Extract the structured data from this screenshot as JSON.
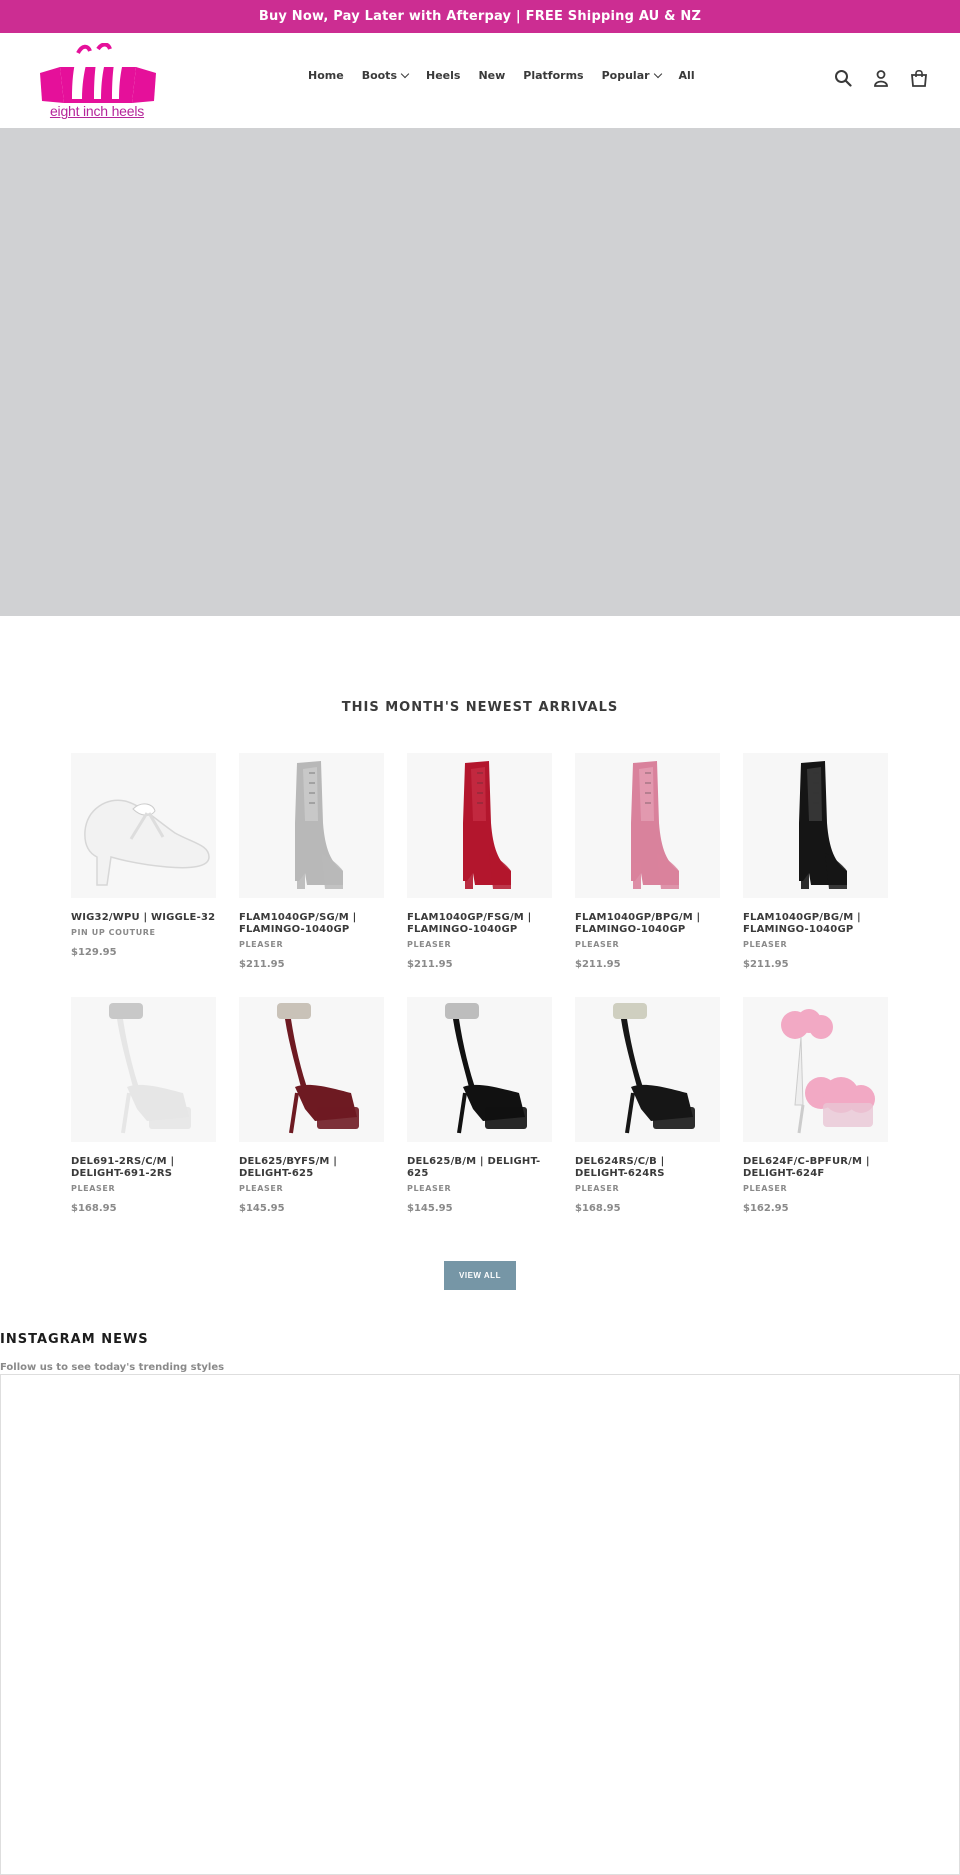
{
  "announcement": {
    "text": "Buy Now, Pay Later with Afterpay | FREE Shipping AU & NZ"
  },
  "logo": {
    "text": "eight inch heels",
    "color": "#e5109a"
  },
  "nav": {
    "items": [
      {
        "label": "Home",
        "dropdown": false
      },
      {
        "label": "Boots",
        "dropdown": true
      },
      {
        "label": "Heels",
        "dropdown": false
      },
      {
        "label": "New",
        "dropdown": false
      },
      {
        "label": "Platforms",
        "dropdown": false
      },
      {
        "label": "Popular",
        "dropdown": true
      },
      {
        "label": "All",
        "dropdown": false
      }
    ]
  },
  "header_icons": [
    "search-icon",
    "account-icon",
    "cart-icon"
  ],
  "section": {
    "title": "THIS MONTH'S NEWEST ARRIVALS"
  },
  "products": [
    {
      "name": "WIG32/WPU | WIGGLE-32",
      "vendor": "PIN UP COUTURE",
      "price": "$129.95",
      "shoe": "pump",
      "color": "#f2f2f2",
      "accent": "#ffffff"
    },
    {
      "name": "FLAM1040GP/SG/M | FLAMINGO-1040GP",
      "vendor": "PLEASER",
      "price": "$211.95",
      "shoe": "boot",
      "color": "#b8b8b8",
      "accent": "#d8d8d8"
    },
    {
      "name": "FLAM1040GP/FSG/M | FLAMINGO-1040GP",
      "vendor": "PLEASER",
      "price": "$211.95",
      "shoe": "boot",
      "color": "#b3162d",
      "accent": "#d13a52"
    },
    {
      "name": "FLAM1040GP/BPG/M | FLAMINGO-1040GP",
      "vendor": "PLEASER",
      "price": "$211.95",
      "shoe": "boot",
      "color": "#d9829c",
      "accent": "#ecb0c2"
    },
    {
      "name": "FLAM1040GP/BG/M | FLAMINGO-1040GP",
      "vendor": "PLEASER",
      "price": "$211.95",
      "shoe": "boot",
      "color": "#151515",
      "accent": "#555555"
    },
    {
      "name": "DEL691-2RS/C/M | DELIGHT-691-2RS",
      "vendor": "PLEASER",
      "price": "$168.95",
      "shoe": "sandal",
      "color": "#e6e6e6",
      "accent": "#c8c8c8"
    },
    {
      "name": "DEL625/BYFS/M | DELIGHT-625",
      "vendor": "PLEASER",
      "price": "$145.95",
      "shoe": "sandal",
      "color": "#6e1a22",
      "accent": "#c9c2b8"
    },
    {
      "name": "DEL625/B/M | DELIGHT-625",
      "vendor": "PLEASER",
      "price": "$145.95",
      "shoe": "sandal",
      "color": "#111111",
      "accent": "#bdbdbd"
    },
    {
      "name": "DEL624RS/C/B | DELIGHT-624RS",
      "vendor": "PLEASER",
      "price": "$168.95",
      "shoe": "sandal",
      "color": "#161616",
      "accent": "#cfcfc0"
    },
    {
      "name": "DEL624F/C-BPFUR/M | DELIGHT-624F",
      "vendor": "PLEASER",
      "price": "$162.95",
      "shoe": "fur",
      "color": "#f2a9c4",
      "accent": "#e9c5d4"
    }
  ],
  "view_all": {
    "label": "VIEW ALL"
  },
  "instagram": {
    "title": "INSTAGRAM NEWS",
    "subtitle": "Follow us to see today's trending styles"
  },
  "colors": {
    "brand": "#cc2d92",
    "hero_placeholder": "#d0d1d3",
    "button": "#7696a6"
  }
}
